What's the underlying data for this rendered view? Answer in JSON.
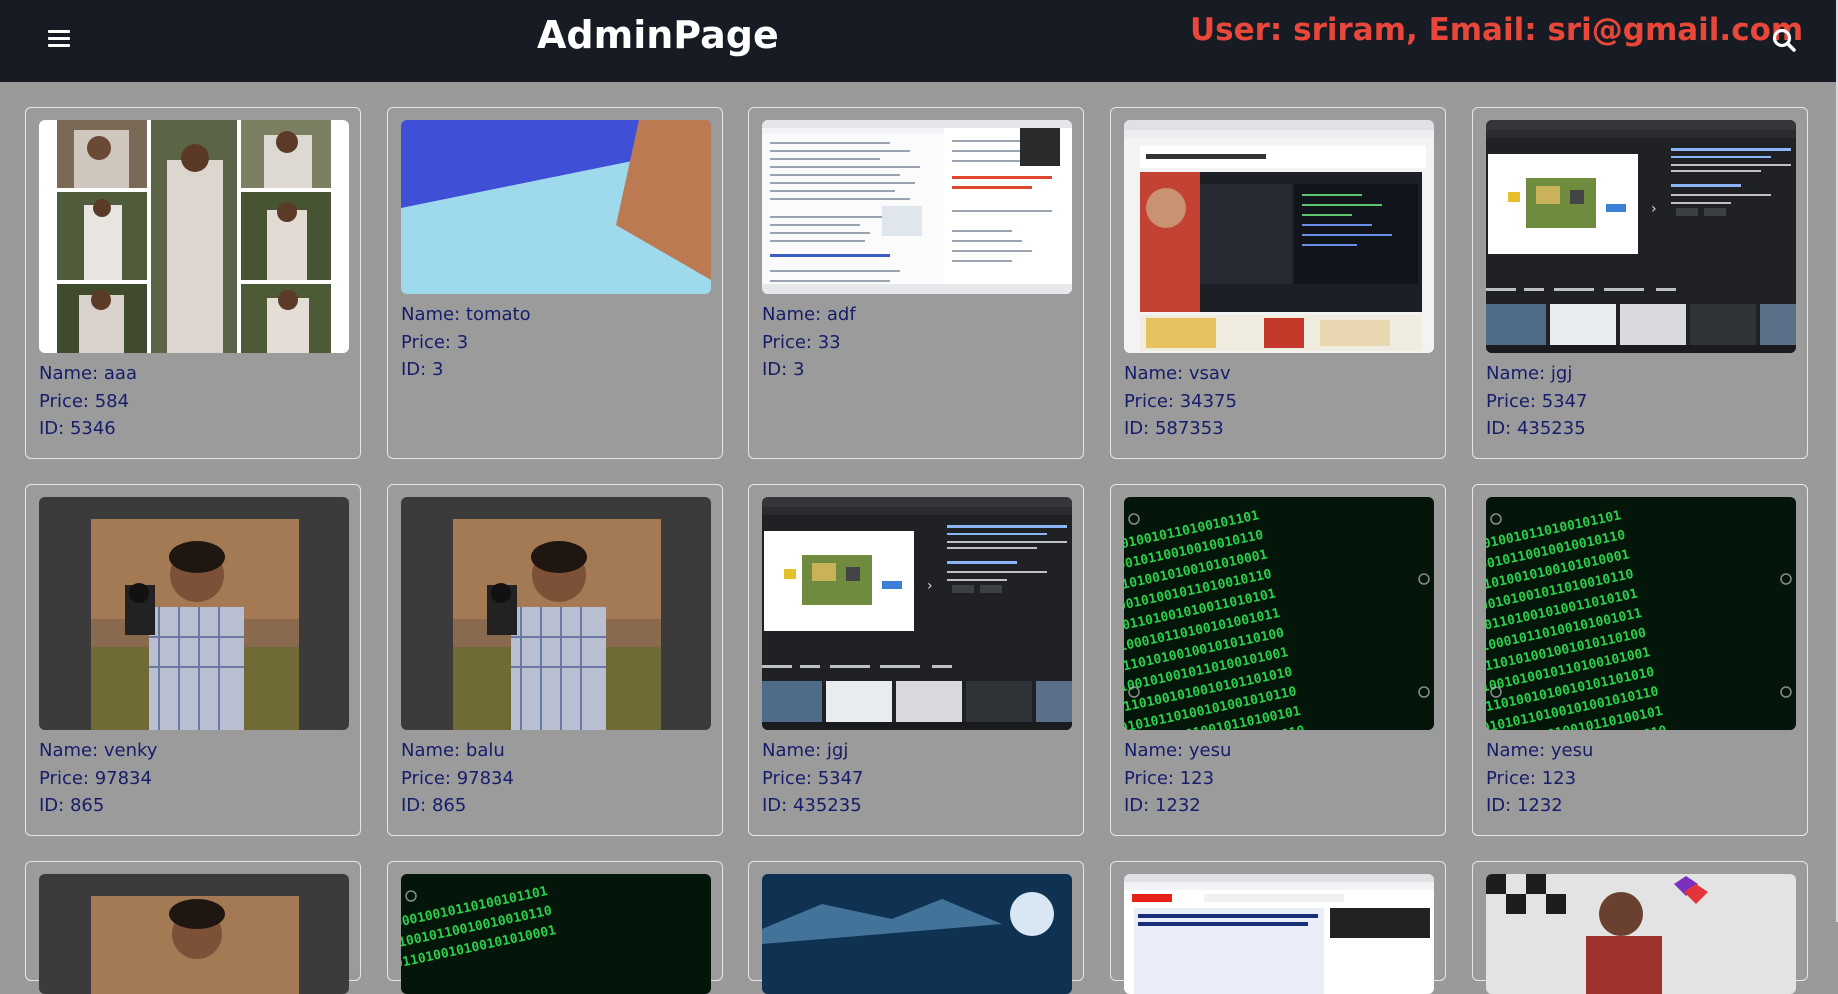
{
  "header": {
    "title": "AdminPage",
    "user_info": "User: sriram, Email: sri@gmail.com",
    "menu_icon": "hamburger-menu-icon",
    "search_icon": "search-icon",
    "accent_color": "#e9473a",
    "bar_color": "#161b24"
  },
  "products": [
    {
      "name": "Name: aaa",
      "price": "Price: 584",
      "id": "ID: 5346",
      "thumbnail": "photo-collage-woman"
    },
    {
      "name": "Name: tomato",
      "price": "Price: 3",
      "id": "ID: 3",
      "thumbnail": "abstract-color-shapes"
    },
    {
      "name": "Name: adf",
      "price": "Price: 33",
      "id": "ID: 3",
      "thumbnail": "webpage-screenshot"
    },
    {
      "name": "Name: vsav",
      "price": "Price: 34375",
      "id": "ID: 587353",
      "thumbnail": "video-tutorial-screenshot"
    },
    {
      "name": "Name: jgj",
      "price": "Price: 5347",
      "id": "ID: 435235",
      "thumbnail": "raspberry-pi-search-screenshot"
    },
    {
      "name": "Name: venky",
      "price": "Price: 97834",
      "id": "ID: 865",
      "thumbnail": "man-with-camera-photo"
    },
    {
      "name": "Name: balu",
      "price": "Price: 97834",
      "id": "ID: 865",
      "thumbnail": "man-with-camera-photo"
    },
    {
      "name": "Name: jgj",
      "price": "Price: 5347",
      "id": "ID: 435235",
      "thumbnail": "raspberry-pi-search-screenshot"
    },
    {
      "name": "Name: yesu",
      "price": "Price: 123",
      "id": "ID: 1232",
      "thumbnail": "green-binary-code"
    },
    {
      "name": "Name: yesu",
      "price": "Price: 123",
      "id": "ID: 1232",
      "thumbnail": "green-binary-code"
    },
    {
      "name": "",
      "price": "",
      "id": "",
      "thumbnail": "man-with-camera-photo"
    },
    {
      "name": "",
      "price": "",
      "id": "",
      "thumbnail": "green-binary-code"
    },
    {
      "name": "",
      "price": "",
      "id": "",
      "thumbnail": "blue-space-scene"
    },
    {
      "name": "",
      "price": "",
      "id": "",
      "thumbnail": "youtube-screenshot"
    },
    {
      "name": "",
      "price": "",
      "id": "",
      "thumbnail": "person-at-banner"
    }
  ]
}
